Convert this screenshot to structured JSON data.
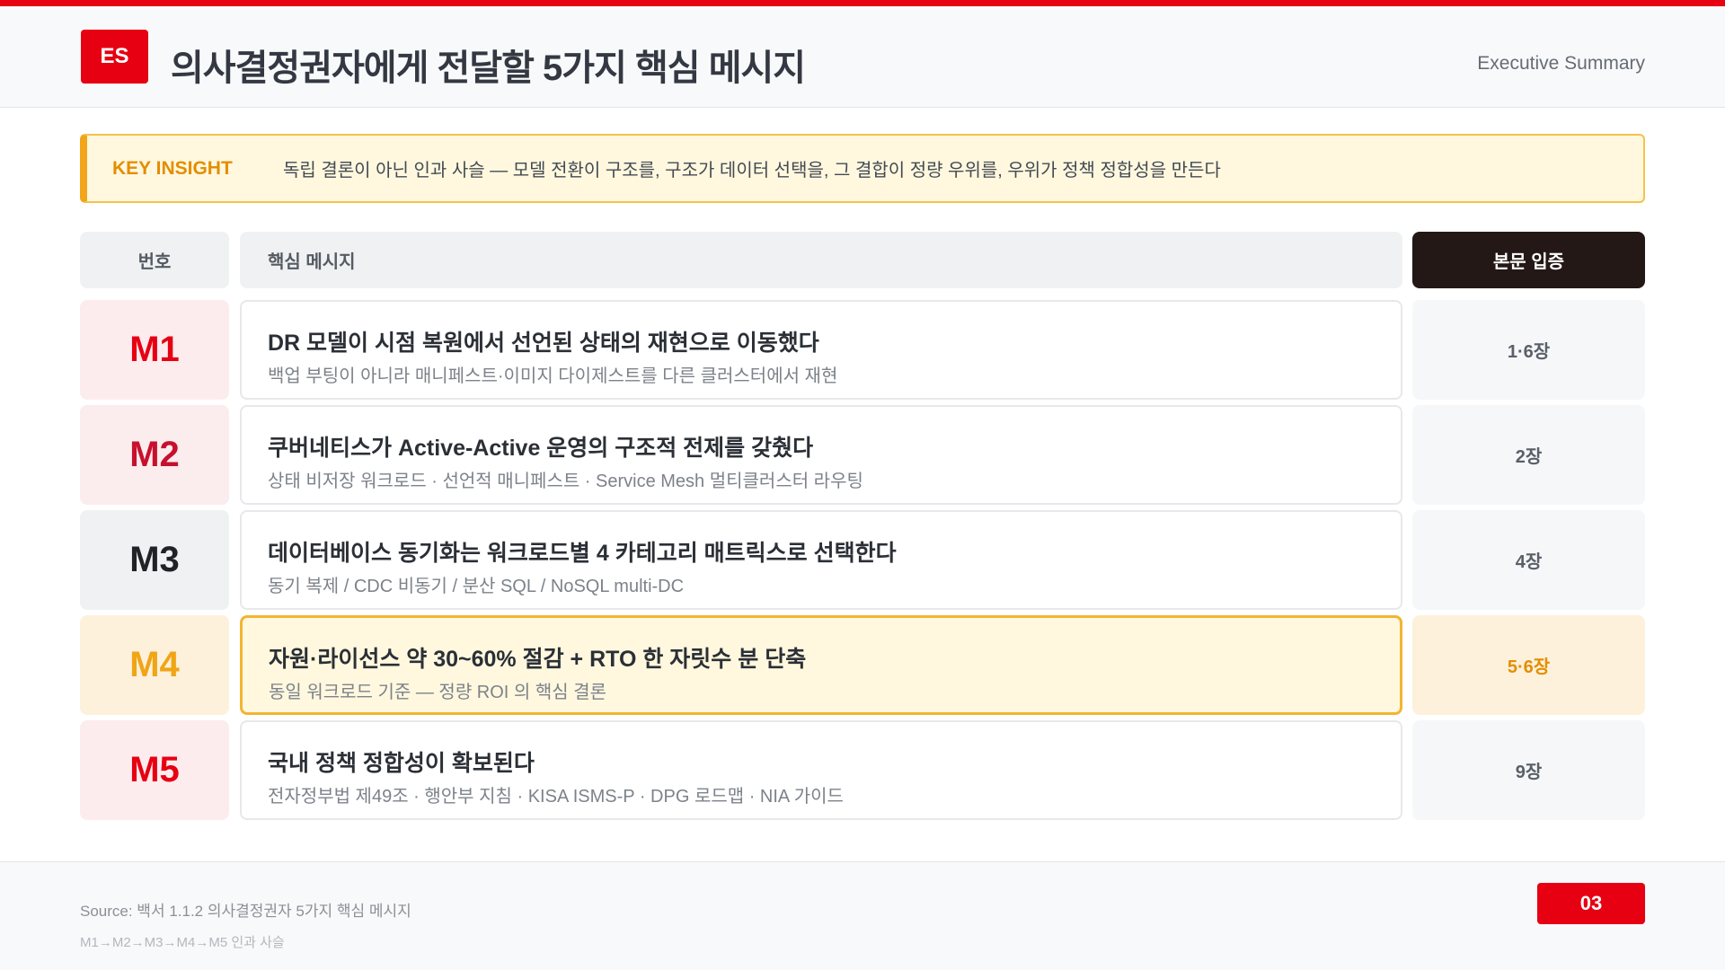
{
  "header": {
    "badge": "ES",
    "title": "의사결정권자에게 전달할 5가지 핵심 메시지",
    "subtitle": "Executive Summary"
  },
  "insight": {
    "label": "KEY INSIGHT",
    "text": "독립 결론이 아닌 인과 사슬 — 모델 전환이 구조를, 구조가 데이터 선택을, 그 결합이 정량 우위를, 우위가 정책 정합성을 만든다"
  },
  "table": {
    "headers": {
      "no": "번호",
      "message": "핵심 메시지",
      "evidence": "본문 입증"
    },
    "rows": [
      {
        "id": "M1",
        "title": "DR 모델이 시점 복원에서 선언된 상태의 재현으로 이동했다",
        "sub": "백업 부팅이 아니라 매니페스트·이미지 다이제스트를 다른 클러스터에서 재현",
        "evidence": "1·6장"
      },
      {
        "id": "M2",
        "title": "쿠버네티스가 Active-Active 운영의 구조적 전제를 갖췄다",
        "sub": "상태 비저장 워크로드 · 선언적 매니페스트 · Service Mesh 멀티클러스터 라우팅",
        "evidence": "2장"
      },
      {
        "id": "M3",
        "title": "데이터베이스 동기화는 워크로드별 4 카테고리 매트릭스로 선택한다",
        "sub": "동기 복제 / CDC 비동기 / 분산 SQL / NoSQL multi-DC",
        "evidence": "4장"
      },
      {
        "id": "M4",
        "title": "자원·라이선스 약 30~60% 절감 + RTO 한 자릿수 분 단축",
        "sub": "동일 워크로드 기준 — 정량 ROI 의 핵심 결론",
        "evidence": "5·6장"
      },
      {
        "id": "M5",
        "title": "국내 정책 정합성이 확보된다",
        "sub": "전자정부법 제49조 · 행안부 지침 · KISA ISMS-P · DPG 로드맵 · NIA 가이드",
        "evidence": "9장"
      }
    ]
  },
  "footer": {
    "source": "Source: 백서 1.1.2 의사결정권자 5가지 핵심 메시지",
    "chain": "M1→M2→M3→M4→M5 인과 사슬",
    "page": "03"
  },
  "colors": {
    "brand_red": "#e60012",
    "highlight_amber": "#f2a51a",
    "evidence_header_bg": "#231815"
  }
}
